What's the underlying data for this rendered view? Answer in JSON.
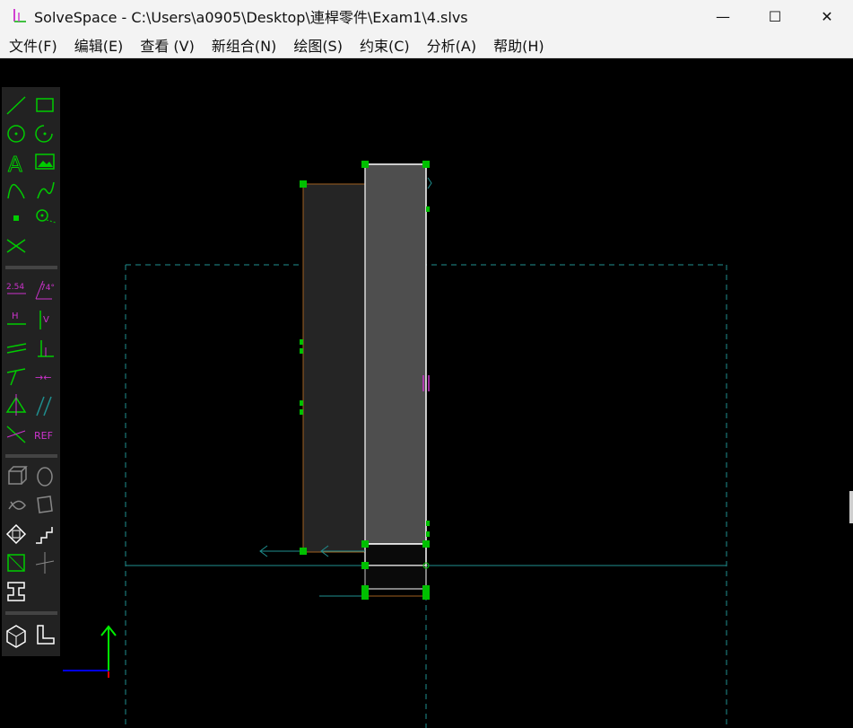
{
  "window": {
    "title": "SolveSpace - C:\\Users\\a0905\\Desktop\\連桿零件\\Exam1\\4.slvs",
    "minimize_glyph": "—",
    "maximize_glyph": "☐",
    "close_glyph": "✕"
  },
  "menu": {
    "items": [
      "文件(F)",
      "编辑(E)",
      "查看 (V)",
      "新组合(N)",
      "绘图(S)",
      "约束(C)",
      "分析(A)",
      "帮助(H)"
    ]
  },
  "toolbar": {
    "dimension_label": "2.54",
    "angle_label": "74°",
    "horizontal_label": "H",
    "vertical_label": "V",
    "reference_label": "REF",
    "text_label": "A"
  },
  "colors": {
    "toolbar_green": "#00cc00",
    "toolbar_magenta": "#cc33cc",
    "construction_cyan": "#1f8f8f",
    "point_green": "#00c000",
    "edge_orange": "#a06020",
    "axis_blue": "#0000ee",
    "axis_green": "#00ee00",
    "axis_red": "#ee0000"
  }
}
